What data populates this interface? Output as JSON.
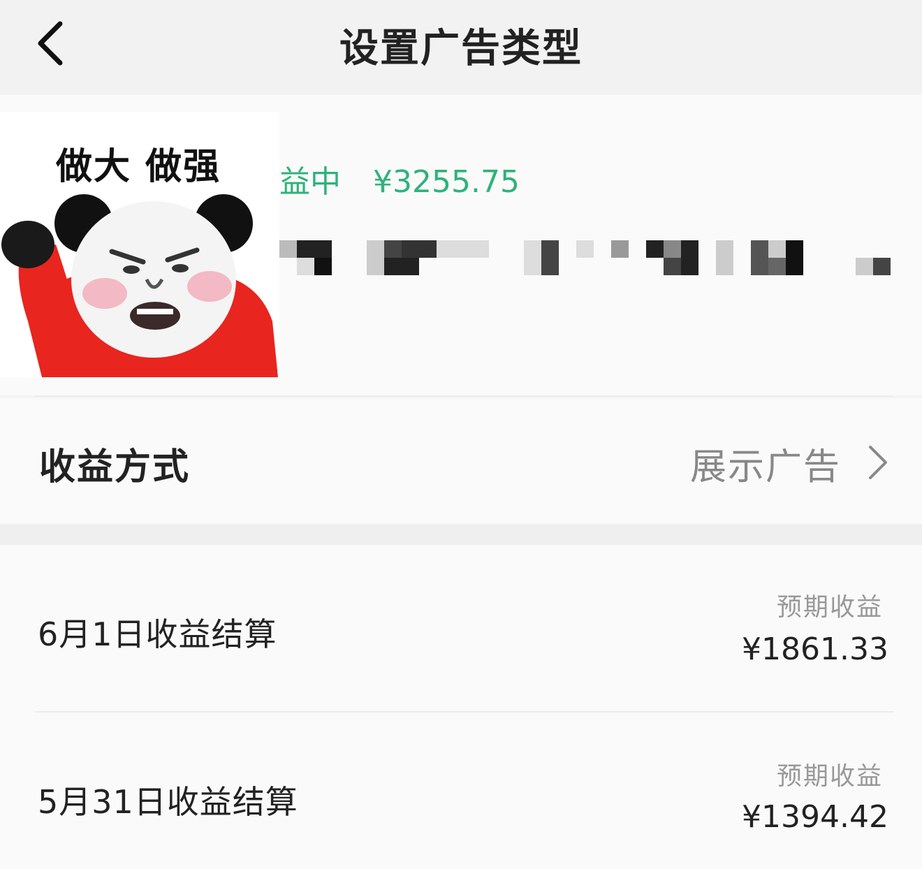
{
  "header": {
    "title": "设置广告类型"
  },
  "meme": {
    "caption": "做大 做强"
  },
  "earnings": {
    "status_fragment": "益中",
    "amount": "¥3255.75",
    "accent_color": "#2fb27b"
  },
  "method": {
    "label": "收益方式",
    "value": "展示广告"
  },
  "settlements": [
    {
      "label": "6月1日收益结算",
      "sub": "预期收益",
      "amount": "¥1861.33"
    },
    {
      "label": "5月31日收益结算",
      "sub": "预期收益",
      "amount": "¥1394.42"
    }
  ]
}
